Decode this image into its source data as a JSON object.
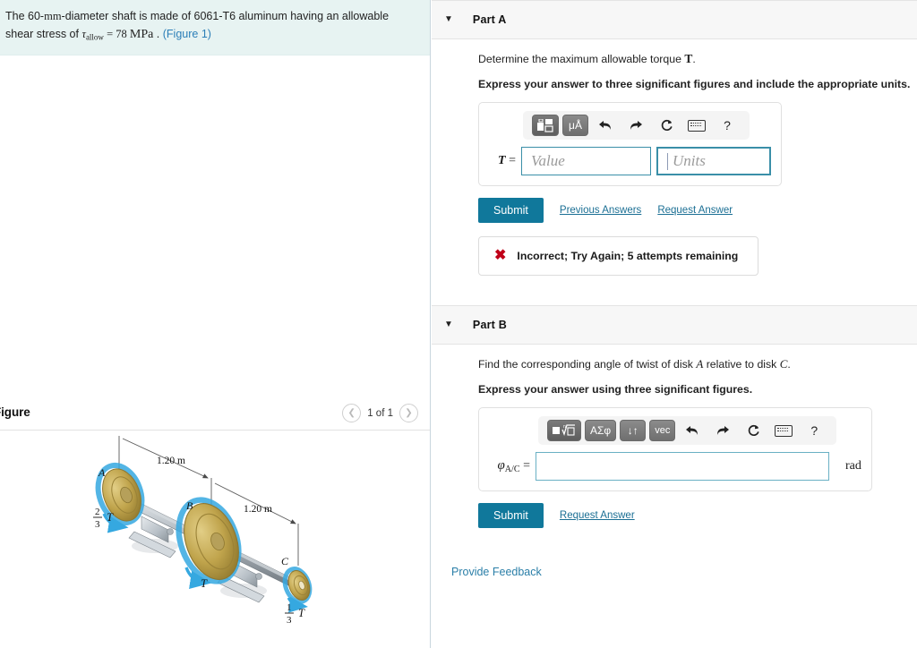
{
  "problem": {
    "text_part1": "The 60-",
    "unit_mm": "mm",
    "text_part2": "-diameter shaft is made of 6061-T6 aluminum having an allowable shear stress of ",
    "tau_symbol": "τ",
    "tau_sub": "allow",
    "equals_value": " = 78 ",
    "mpa": "MPa",
    "period": " . ",
    "figure_link": "(Figure 1)"
  },
  "figure": {
    "title": "Figure",
    "title_visible": "igure",
    "counter": "1 of 1",
    "prev_icon": "chevron-left-icon",
    "next_icon": "chevron-right-icon",
    "diagram": {
      "labels": {
        "disk_a": "A",
        "disk_b": "B",
        "disk_c": "C",
        "dim_1": "1.20 m",
        "dim_2": "1.20 m",
        "torque_a_num": "2",
        "torque_a_den": "3",
        "torque_a_sym": "T",
        "torque_b_sym": "T",
        "torque_c_num": "1",
        "torque_c_den": "3",
        "torque_c_sym": "T"
      },
      "colors": {
        "disk_fill": "#bda24a",
        "disk_edge": "#8d7731",
        "shaft": "#a9b0b7",
        "arrow_blue": "#35a8e0",
        "support": "#c6ccd2"
      }
    }
  },
  "parts": [
    {
      "id": "part-a",
      "label": "Part A",
      "caret": "▼",
      "prompt": "Determine the maximum allowable torque ",
      "prompt_symbol": "T",
      "prompt_tail": ".",
      "instruction": "Express your answer to three significant figures and include the appropriate units.",
      "toolbar": [
        {
          "name": "template-blocks-icon",
          "label": "",
          "type": "glyph-blocks"
        },
        {
          "name": "micro-angstrom-units-icon",
          "label": "μÅ",
          "type": "text"
        },
        {
          "name": "undo-icon",
          "label": "↰",
          "type": "plain"
        },
        {
          "name": "redo-icon",
          "label": "↱",
          "type": "plain"
        },
        {
          "name": "reset-icon",
          "label": "↻",
          "type": "plain"
        },
        {
          "name": "keyboard-icon",
          "label": "",
          "type": "keyboard"
        },
        {
          "name": "help-icon",
          "label": "?",
          "type": "plain"
        }
      ],
      "equation_label": "T",
      "equation_eq": "=",
      "value_placeholder": "Value",
      "units_placeholder": "Units",
      "submit_label": "Submit",
      "links": [
        "Previous Answers",
        "Request Answer"
      ],
      "feedback": {
        "icon": "error-x-icon",
        "mark": "✖",
        "message": "Incorrect; Try Again; 5 attempts remaining"
      }
    },
    {
      "id": "part-b",
      "label": "Part B",
      "caret": "▼",
      "prompt": "Find the corresponding angle of twist of disk ",
      "prompt_symbol": "A",
      "prompt_mid": " relative to disk ",
      "prompt_symbol2": "C",
      "prompt_tail": ".",
      "instruction": "Express your answer using three significant figures.",
      "toolbar": [
        {
          "name": "template-root-icon",
          "label": "",
          "type": "glyph-root"
        },
        {
          "name": "greek-symbols-icon",
          "label": "ΑΣφ",
          "type": "text"
        },
        {
          "name": "arrows-updown-icon",
          "label": "↓↑",
          "type": "text"
        },
        {
          "name": "vector-icon",
          "label": "vec",
          "type": "text"
        },
        {
          "name": "undo-icon",
          "label": "↰",
          "type": "plain"
        },
        {
          "name": "redo-icon",
          "label": "↱",
          "type": "plain"
        },
        {
          "name": "reset-icon",
          "label": "↻",
          "type": "plain"
        },
        {
          "name": "keyboard-icon",
          "label": "",
          "type": "keyboard"
        },
        {
          "name": "help-icon",
          "label": "?",
          "type": "plain"
        }
      ],
      "equation_label": "φ",
      "equation_sub": "A/C",
      "equation_eq": "=",
      "answer_value": "",
      "unit_suffix": "rad",
      "submit_label": "Submit",
      "links": [
        "Request Answer"
      ]
    }
  ],
  "footer": {
    "provide_feedback": "Provide Feedback"
  },
  "colors": {
    "accent": "#10789b",
    "link": "#1b6f94",
    "problem_bg": "#e7f3f2",
    "header_bg": "#f7f7f7",
    "error": "#c00018",
    "field_border": "#3a8fa8"
  }
}
